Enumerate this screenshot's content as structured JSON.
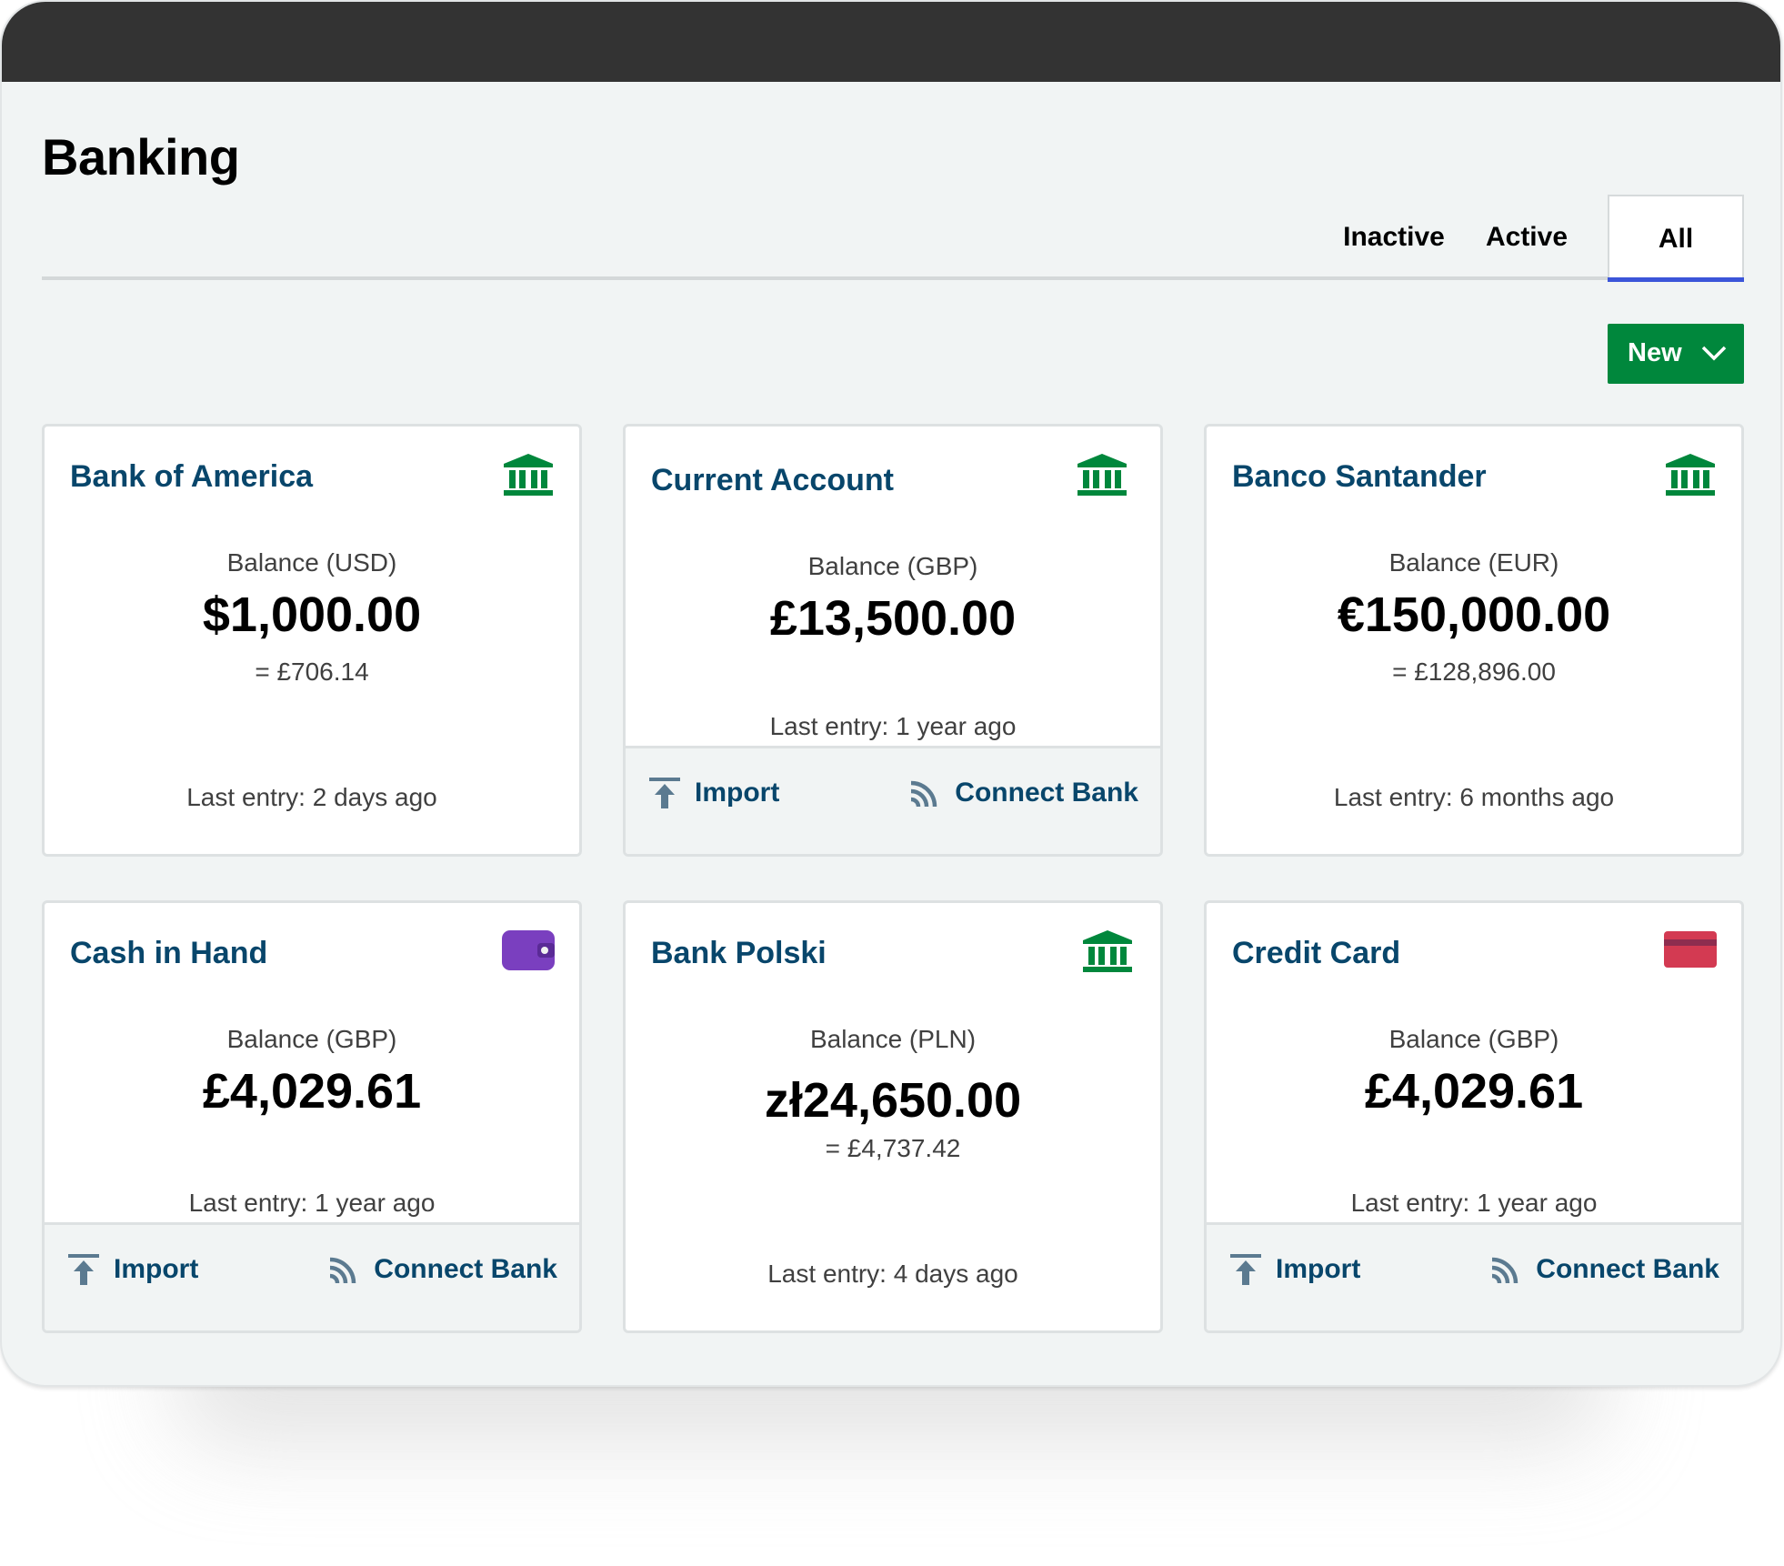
{
  "page": {
    "title": "Banking"
  },
  "tabs": [
    {
      "label": "Inactive"
    },
    {
      "label": "Active"
    },
    {
      "label": "All",
      "selected": true
    }
  ],
  "new_button": {
    "label": "New"
  },
  "accounts": [
    {
      "name": "Bank of America",
      "icon": "bank-icon",
      "balance_label": "Balance (USD)",
      "balance": "$1,000.00",
      "converted": "= £706.14",
      "last_entry": "Last entry: 2 days ago"
    },
    {
      "name": "Current Account",
      "icon": "bank-icon",
      "balance_label": "Balance (GBP)",
      "balance": "£13,500.00",
      "last_entry": "Last entry: 1 year ago",
      "actions": {
        "import": "Import",
        "connect": "Connect Bank"
      }
    },
    {
      "name": "Banco Santander",
      "icon": "bank-icon",
      "balance_label": "Balance (EUR)",
      "balance": "€150,000.00",
      "converted": "= £128,896.00",
      "last_entry": "Last entry: 6 months ago"
    },
    {
      "name": "Cash in Hand",
      "icon": "wallet-icon",
      "balance_label": "Balance (GBP)",
      "balance": "£4,029.61",
      "last_entry": "Last entry: 1 year ago",
      "actions": {
        "import": "Import",
        "connect": "Connect Bank"
      }
    },
    {
      "name": "Bank Polski",
      "icon": "bank-icon",
      "balance_label": "Balance (PLN)",
      "balance": "zł24,650.00",
      "converted": "= £4,737.42",
      "last_entry": "Last entry: 4 days ago"
    },
    {
      "name": "Credit Card",
      "icon": "credit-card-icon",
      "balance_label": "Balance (GBP)",
      "balance": "£4,029.61",
      "last_entry": "Last entry: 1 year ago",
      "actions": {
        "import": "Import",
        "connect": "Connect Bank"
      }
    }
  ],
  "colors": {
    "accent_green": "#00873c",
    "tab_indicator": "#3b55d9",
    "title_blue": "#08466b",
    "wallet_purple": "#7a3fbf",
    "card_red": "#d33a52"
  }
}
